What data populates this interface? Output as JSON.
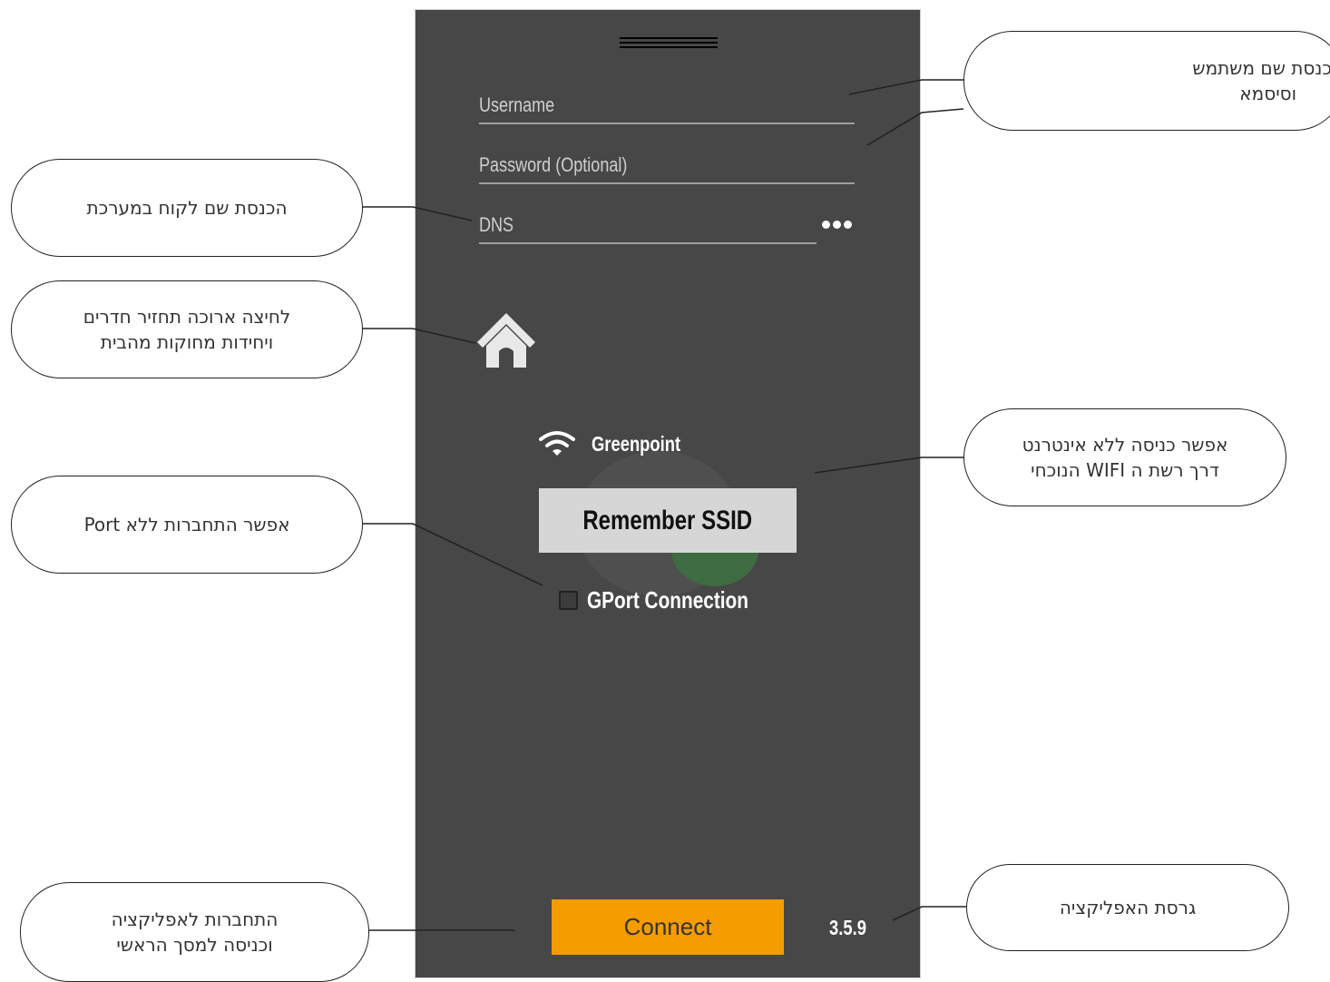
{
  "app": {
    "menu_icon": "hamburger-menu-icon",
    "username_placeholder": "Username",
    "password_placeholder": "Password (Optional)",
    "dns_placeholder": "DNS",
    "more_icon": "more-dots-icon",
    "home_icon": "home-icon",
    "wifi_icon": "wifi-icon",
    "ssid": "Greenpoint",
    "remember_ssid_label": "Remember SSID",
    "gport_label": "GPort Connection",
    "gport_checked": false,
    "connect_label": "Connect",
    "version": "3.5.9",
    "accent_color": "#f59c00",
    "background_color": "#474747"
  },
  "callouts": {
    "user_password": [
      "הכנסת שם משתמש",
      "וסיסמא"
    ],
    "customer_name": [
      "הכנסת שם לקוח במערכת"
    ],
    "long_press_home": [
      "לחיצה ארוכה תחזיר חדרים",
      "ויחידות מחוקות מהבית"
    ],
    "no_port": [
      "אפשר התחברות ללא Port"
    ],
    "offline_wifi": [
      "אפשר כניסה ללא אינטרנט",
      "דרך רשת ה WIFI הנוכחי"
    ],
    "app_version": [
      "גרסת האפליקציה"
    ],
    "connect_main": [
      "התחברות לאפליקציה",
      "וכניסה למסך הראשי"
    ]
  }
}
